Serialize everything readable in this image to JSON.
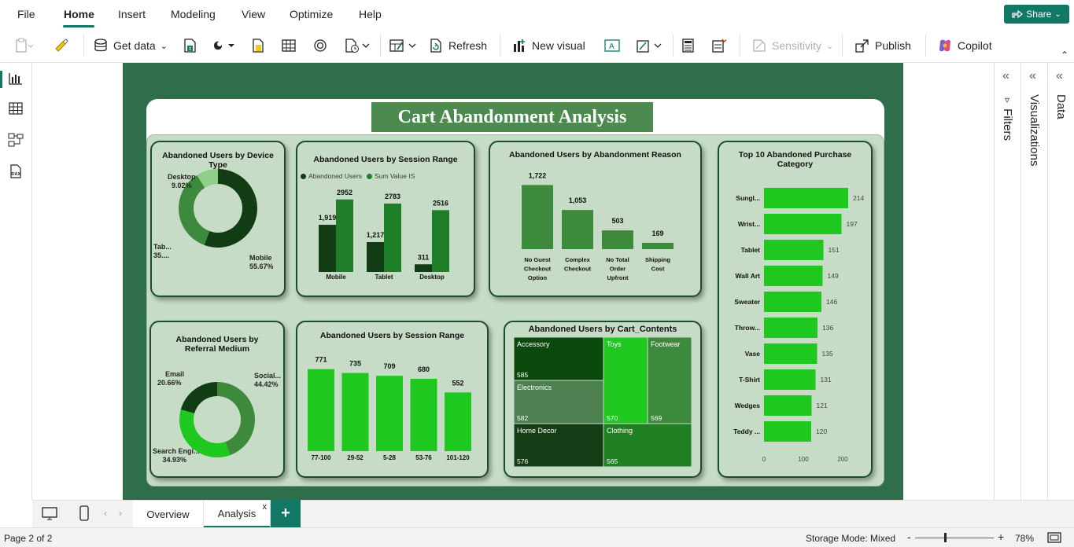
{
  "menu": {
    "items": [
      "File",
      "Home",
      "Insert",
      "Modeling",
      "View",
      "Optimize",
      "Help"
    ],
    "share_label": "Share"
  },
  "ribbon": {
    "get_data": "Get data",
    "refresh": "Refresh",
    "new_visual": "New visual",
    "sensitivity": "Sensitivity",
    "publish": "Publish",
    "copilot": "Copilot"
  },
  "panes": {
    "filters": "Filters",
    "visualizations": "Visualizations",
    "data": "Data"
  },
  "report": {
    "title": "Cart Abandonment Analysis",
    "device_card": {
      "title": "Abandoned Users by Device Type",
      "labels": [
        {
          "name": "Desktop",
          "pct": "9.02%"
        },
        {
          "name": "Tab...",
          "pct": "35...."
        },
        {
          "name": "Mobile",
          "pct": "55.67%"
        }
      ]
    },
    "session_card1": {
      "title": "Abandoned Users by Session Range",
      "legend": [
        "Abandoned Users",
        "Sum Value IS"
      ]
    },
    "reason_card": {
      "title": "Abandoned Users by Abandonment Reason"
    },
    "top10_card": {
      "title": "Top 10 Abandoned Purchase Category"
    },
    "referral_card": {
      "title": "Abandoned Users by Referral Medium",
      "labels": [
        {
          "name": "Email",
          "pct": "20.66%"
        },
        {
          "name": "Social...",
          "pct": "44.42%"
        },
        {
          "name": "Search Engi...",
          "pct": "34.93%"
        }
      ]
    },
    "session_card2": {
      "title": "Abandoned Users by Session Range"
    },
    "cart_card": {
      "title": "Abandoned Users by Cart_Contents"
    }
  },
  "chart_data": [
    {
      "type": "pie",
      "title": "Abandoned Users by Device Type",
      "categories": [
        "Mobile",
        "Tablet",
        "Desktop"
      ],
      "values": [
        55.67,
        35.31,
        9.02
      ],
      "colors": [
        "#123d14",
        "#3d8a3d",
        "#8fcf8a"
      ]
    },
    {
      "type": "bar",
      "title": "Abandoned Users by Session Range",
      "categories": [
        "Mobile",
        "Tablet",
        "Desktop"
      ],
      "series": [
        {
          "name": "Abandoned Users",
          "values": [
            1919,
            1217,
            311
          ],
          "labels": [
            "1,919",
            "1,217",
            "311"
          ],
          "color": "#123d14"
        },
        {
          "name": "Sum Value IS",
          "values": [
            2952,
            2783,
            2516
          ],
          "labels": [
            "2952",
            "2783",
            "2516"
          ],
          "color": "#1f7f28"
        }
      ],
      "ylim": [
        0,
        3200
      ]
    },
    {
      "type": "bar",
      "title": "Abandoned Users by Abandonment Reason",
      "categories": [
        "No Guest Checkout Option",
        "Complex Checkout",
        "No Total Order Upfront",
        "Shipping Cost"
      ],
      "values": [
        1722,
        1053,
        503,
        169
      ],
      "labels": [
        "1,722",
        "1,053",
        "503",
        "169"
      ],
      "ylim": [
        0,
        1900
      ]
    },
    {
      "type": "bar",
      "orientation": "horizontal",
      "title": "Top 10 Abandoned Purchase Category",
      "categories": [
        "Sungl...",
        "Wrist...",
        "Tablet",
        "Wall Art",
        "Sweater",
        "Throw...",
        "Vase",
        "T-Shirt",
        "Wedges",
        "Teddy ..."
      ],
      "values": [
        214,
        197,
        151,
        149,
        146,
        136,
        135,
        131,
        121,
        120
      ],
      "xticks": [
        "0",
        "100",
        "200"
      ],
      "xlim": [
        0,
        260
      ]
    },
    {
      "type": "pie",
      "title": "Abandoned Users by Referral Medium",
      "categories": [
        "Social Media",
        "Search Engine",
        "Email"
      ],
      "values": [
        44.42,
        34.93,
        20.66
      ],
      "colors": [
        "#3d8a3d",
        "#1fc81f",
        "#123d14"
      ]
    },
    {
      "type": "bar",
      "title": "Abandoned Users by Session Range",
      "categories": [
        "77-100",
        "29-52",
        "5-28",
        "53-76",
        "101-120"
      ],
      "values": [
        771,
        735,
        709,
        680,
        552
      ],
      "ylim": [
        0,
        850
      ]
    },
    {
      "type": "heatmap",
      "title": "Abandoned Users by Cart_Contents",
      "cells": [
        {
          "name": "Accessory",
          "value": "585",
          "color": "#0b4a0d"
        },
        {
          "name": "Electronics",
          "value": "582",
          "color": "#4d8050"
        },
        {
          "name": "Home Decor",
          "value": "576",
          "color": "#143c15"
        },
        {
          "name": "Toys",
          "value": "570",
          "color": "#1fc81f"
        },
        {
          "name": "Footwear",
          "value": "569",
          "color": "#3d8a3d"
        },
        {
          "name": "Clothing",
          "value": "565",
          "color": "#1f7f22"
        }
      ]
    }
  ],
  "tabs": {
    "overview": "Overview",
    "analysis": "Analysis",
    "close": "x",
    "add": "+"
  },
  "status": {
    "page": "Page 2 of 2",
    "storage": "Storage Mode: Mixed",
    "zoom": "78%",
    "minus": "-",
    "plus": "+"
  }
}
